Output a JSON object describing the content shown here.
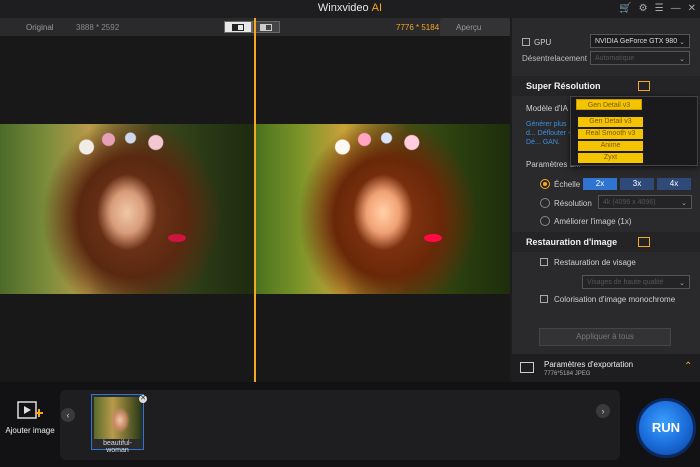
{
  "app": {
    "title": "Winxvideo",
    "title_suffix": "AI"
  },
  "titlebar_icons": [
    "cart-icon",
    "gear-icon",
    "menu-icon",
    "minimize-icon",
    "close-icon"
  ],
  "preview": {
    "left_label": "Original",
    "left_resolution": "3888 * 2592",
    "right_resolution": "7776 * 5184",
    "right_label": "Aperçu"
  },
  "settings": {
    "gpu_label": "GPU",
    "gpu_value": "NVIDIA GeForce GTX 980",
    "deinterlace_label": "Désentrelacement",
    "deinterlace_value": "Automatique"
  },
  "super_resolution": {
    "title": "Super Résolution",
    "model_label": "Modèle d'IA",
    "model_selected": "Gen Detail v3",
    "description": "Générer plus d... Déflouter + Dé... GAN.",
    "params_label": "Paramètres d...",
    "scale_label": "Échelle",
    "scale_options": [
      "2x",
      "3x",
      "4x"
    ],
    "resolution_label": "Résolution",
    "resolution_value": "4k (4096 x 4096)",
    "enhance_label": "Améliorer l'image (1x)"
  },
  "model_dropdown": {
    "options": [
      "Gen Detail v3",
      "Real Smooth v3",
      "Anime",
      "Zyxt"
    ]
  },
  "restoration": {
    "title": "Restauration d'image",
    "face_label": "Restauration de visage",
    "face_value": "Visages de haute qualité",
    "colorize_label": "Colorisation d'image monochrome"
  },
  "apply_all": "Appliquer à tous",
  "export": {
    "title": "Paramètres d'exportation",
    "details": "7776*5184   JPEG"
  },
  "bottom": {
    "add_image": "Ajouter image",
    "thumb_name": "beautiful-woman",
    "run": "RUN"
  },
  "colors": {
    "accent": "#f5a623",
    "blue": "#2f74d0",
    "dropdown": "#f5c400"
  }
}
